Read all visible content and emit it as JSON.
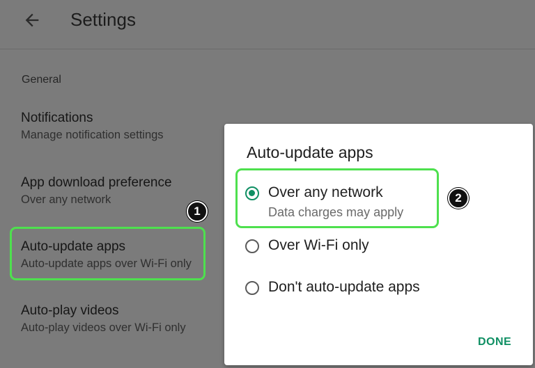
{
  "header": {
    "title": "Settings",
    "back_icon": "arrow-left-icon"
  },
  "section_label": "General",
  "settings": [
    {
      "title": "Notifications",
      "subtitle": "Manage notification settings"
    },
    {
      "title": "App download preference",
      "subtitle": "Over any network"
    },
    {
      "title": "Auto-update apps",
      "subtitle": "Auto-update apps over Wi-Fi only"
    },
    {
      "title": "Auto-play videos",
      "subtitle": "Auto-play videos over Wi-Fi only"
    }
  ],
  "badges": [
    "1",
    "2"
  ],
  "dialog": {
    "title": "Auto-update apps",
    "options": [
      {
        "label": "Over any network",
        "sublabel": "Data charges may apply",
        "selected": true
      },
      {
        "label": "Over Wi-Fi only",
        "selected": false
      },
      {
        "label": "Don't auto-update apps",
        "selected": false
      }
    ],
    "done_label": "DONE"
  },
  "colors": {
    "accent": "#0f8f63",
    "highlight": "#4ee04e",
    "scrim": "#7b7b7b"
  }
}
